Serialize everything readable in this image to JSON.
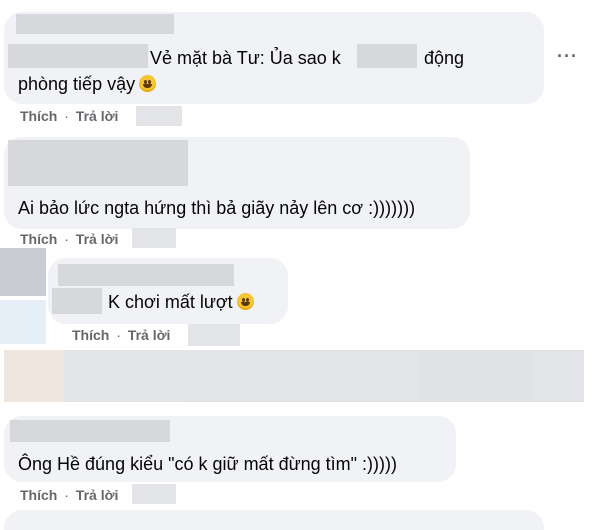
{
  "comments": [
    {
      "text_before": "Vẻ mặt bà Tư: Ủa sao k",
      "text_after": "động",
      "text_line2": "phòng tiếp vậy",
      "emoji": "smiling-face-icon",
      "actions": [
        "Thích",
        "Trả lời"
      ]
    },
    {
      "text": "Ai bảo lức ngta hứng thì bả giãy nảy lên cơ :)))))))",
      "actions": [
        "Thích",
        "Trả lời"
      ]
    },
    {
      "text": "K chơi mất lượt",
      "emoji": "smiling-face-icon",
      "actions": [
        "Thích",
        "Trả lời"
      ]
    },
    {
      "text": "Ông Hề đúng kiểu \"có k giữ mất đừng tìm\" :)))))",
      "actions": [
        "Thích",
        "Trả lời"
      ]
    }
  ],
  "separator": " · ",
  "more_icon": "more-options-icon",
  "colors": {
    "bubble": "#f0f2f5",
    "text": "#050505",
    "secondary": "#65676b",
    "blur": "#d6d8dc"
  }
}
